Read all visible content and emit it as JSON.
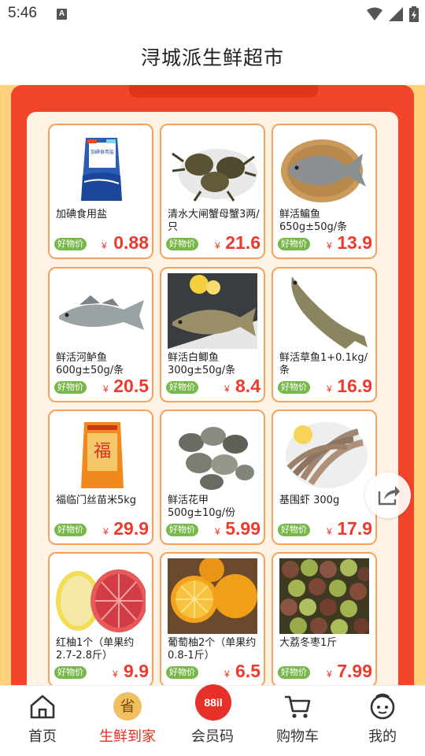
{
  "status_bar": {
    "time": "5:46",
    "notification_letter": "A"
  },
  "header": {
    "title": "浔城派生鲜超市"
  },
  "price_badge_label": "好物价",
  "currency_symbol": "¥",
  "products": [
    {
      "name": "加碘食用盐",
      "price": "0.88",
      "image": "salt-bag",
      "bag_text": "加碘食用盐"
    },
    {
      "name": "清水大闸蟹母蟹3两/只",
      "price": "21.6",
      "image": "crabs"
    },
    {
      "name": "鲜活鳊鱼650g±50g/条",
      "price": "13.9",
      "image": "bream-fish"
    },
    {
      "name": "鲜活河鲈鱼600g±50g/条",
      "price": "20.5",
      "image": "perch-fish"
    },
    {
      "name": "鲜活白鲫鱼300g±50g/条",
      "price": "8.4",
      "image": "crucian-fish"
    },
    {
      "name": "鲜活草鱼1+0.1kg/条",
      "price": "16.9",
      "image": "grass-carp"
    },
    {
      "name": "福临门丝苗米5kg",
      "price": "29.9",
      "image": "rice-bag"
    },
    {
      "name": "鲜活花甲500g±10g/份",
      "price": "5.99",
      "image": "clams"
    },
    {
      "name": "基围虾  300g",
      "price": "17.9",
      "image": "shrimp"
    },
    {
      "name": "红柚1个（单果约2.7-2.8斤）",
      "price": "9.9",
      "image": "pomelo"
    },
    {
      "name": "葡萄柚2个（单果约0.8-1斤）",
      "price": "6.5",
      "image": "grapefruit"
    },
    {
      "name": "大荔冬枣1斤",
      "price": "7.99",
      "image": "jujubes"
    }
  ],
  "tabbar": {
    "items": [
      {
        "label": "首页",
        "icon": "home-icon",
        "active": false
      },
      {
        "label": "生鲜到家",
        "icon": "fresh-icon",
        "active": true
      },
      {
        "label": "会员码",
        "icon": "member-code-icon",
        "active": false
      },
      {
        "label": "购物车",
        "icon": "cart-icon",
        "active": false
      },
      {
        "label": "我的",
        "icon": "profile-icon",
        "active": false
      }
    ],
    "fresh_icon_char": "省",
    "member_code_text": "88il"
  },
  "colors": {
    "accent": "#ee3a2c",
    "badge": "#78b84a",
    "panel_red": "#f0452a",
    "card_border": "#f6a25d",
    "page_bg": "#ffd17a"
  }
}
